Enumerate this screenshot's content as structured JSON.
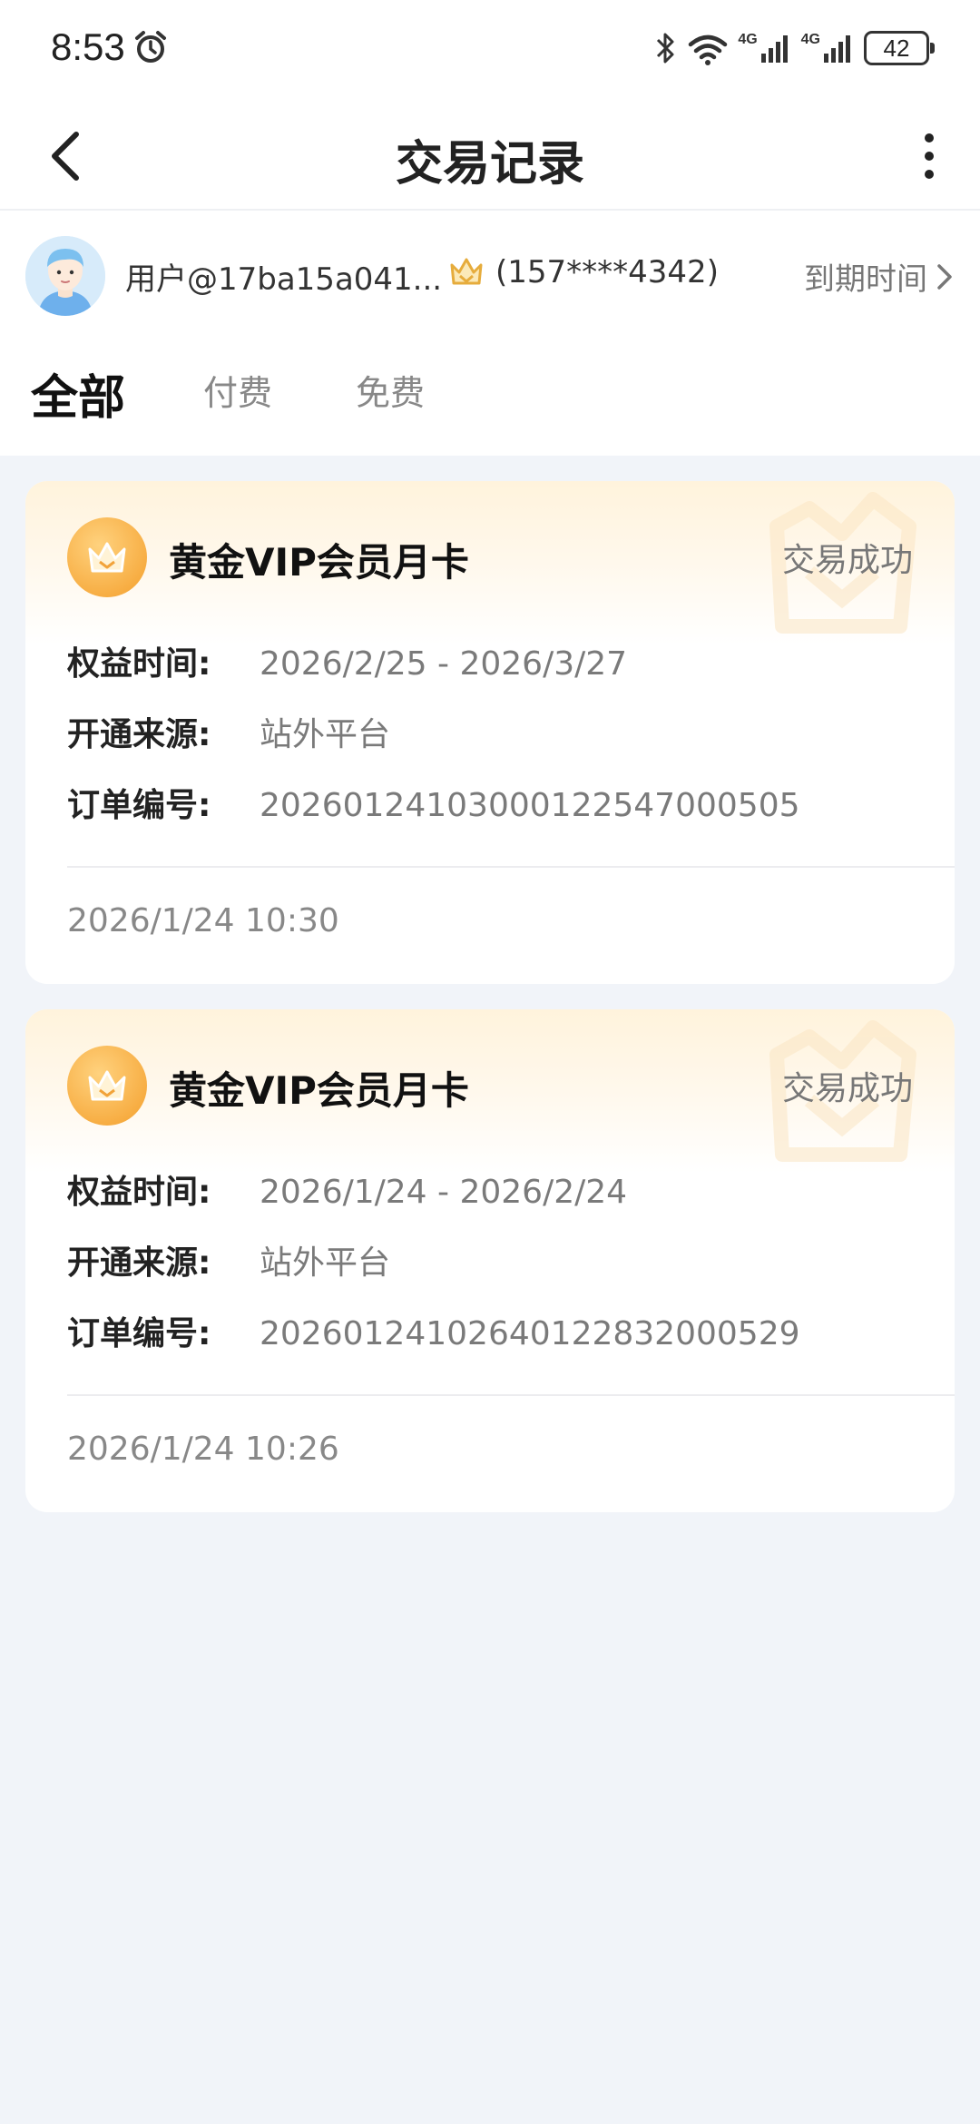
{
  "status_bar": {
    "time": "8:53",
    "network_1": "4G",
    "network_2": "4G",
    "battery": "42"
  },
  "header": {
    "title": "交易记录"
  },
  "user": {
    "name": "用户@17ba15a041...",
    "phone": "(157****4342)",
    "expiry_label": "到期时间"
  },
  "tabs": [
    {
      "label": "全部",
      "active": true
    },
    {
      "label": "付费",
      "active": false
    },
    {
      "label": "免费",
      "active": false
    }
  ],
  "labels": {
    "benefit_period": "权益时间:",
    "source": "开通来源:",
    "order_no": "订单编号:"
  },
  "records": [
    {
      "title": "黄金VIP会员月卡",
      "status": "交易成功",
      "benefit_period": "2026/2/25 - 2026/3/27",
      "source": "站外平台",
      "order_no": "20260124103000122547000505",
      "datetime": "2026/1/24 10:30"
    },
    {
      "title": "黄金VIP会员月卡",
      "status": "交易成功",
      "benefit_period": "2026/1/24 - 2026/2/24",
      "source": "站外平台",
      "order_no": "20260124102640122832000529",
      "datetime": "2026/1/24 10:26"
    }
  ],
  "colors": {
    "accent_gold": "#f6a93c",
    "page_background": "#f1f4f9"
  }
}
